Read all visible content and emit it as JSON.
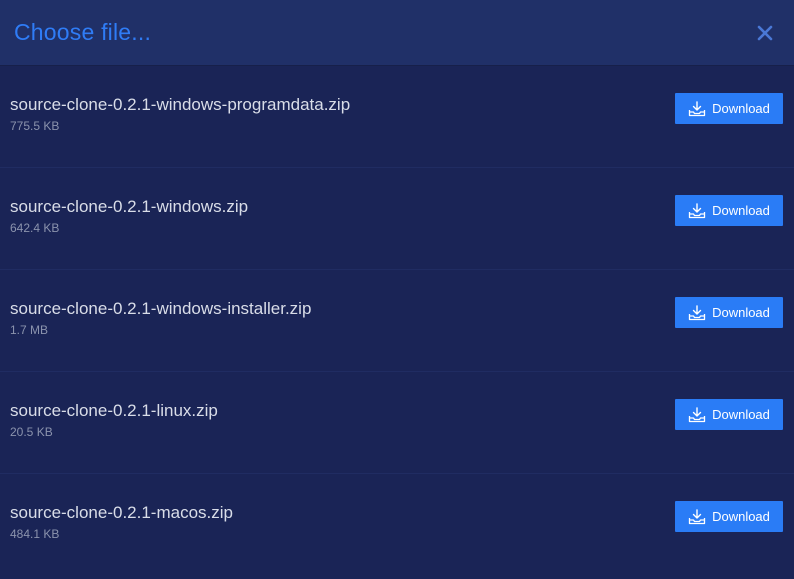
{
  "dialog": {
    "title": "Choose file...",
    "close_icon": "close-icon"
  },
  "files": [
    {
      "name": "source-clone-0.2.1-windows-programdata.zip",
      "size": "775.5 KB",
      "button": "Download"
    },
    {
      "name": "source-clone-0.2.1-windows.zip",
      "size": "642.4 KB",
      "button": "Download"
    },
    {
      "name": "source-clone-0.2.1-windows-installer.zip",
      "size": "1.7 MB",
      "button": "Download"
    },
    {
      "name": "source-clone-0.2.1-linux.zip",
      "size": "20.5 KB",
      "button": "Download"
    },
    {
      "name": "source-clone-0.2.1-macos.zip",
      "size": "484.1 KB",
      "button": "Download"
    }
  ],
  "colors": {
    "accent": "#2a7cf6",
    "background": "#1a2456",
    "header": "#203068"
  },
  "icons": {
    "download": "download-tray-icon"
  }
}
